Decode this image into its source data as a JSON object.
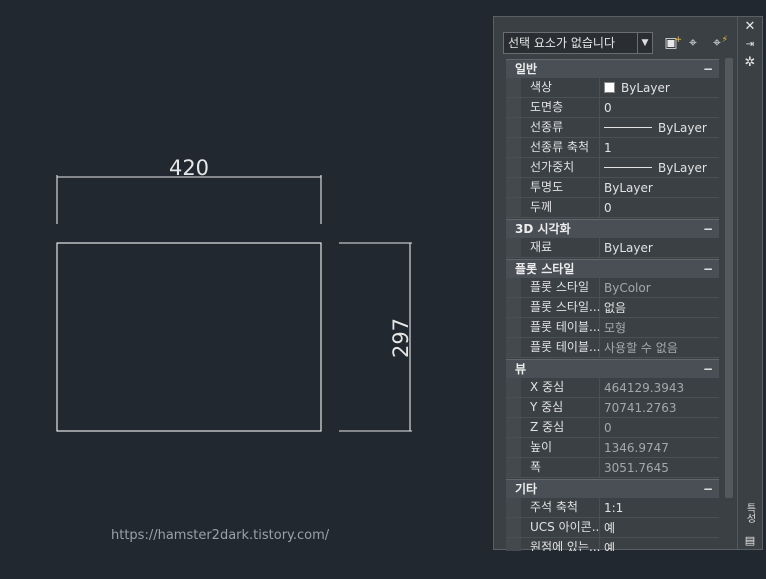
{
  "drawing": {
    "dim_width": "420",
    "dim_height": "297",
    "watermark": "https://hamster2dark.tistory.com/"
  },
  "palette": {
    "selection": "선택 요소가 없습니다",
    "sections": [
      {
        "title": "일반",
        "toggle": "−",
        "rows": [
          {
            "name": "색상",
            "value": "ByLayer",
            "kind": "color"
          },
          {
            "name": "도면층",
            "value": "0"
          },
          {
            "name": "선종류",
            "value": "ByLayer",
            "kind": "line"
          },
          {
            "name": "선종류 축척",
            "value": "1"
          },
          {
            "name": "선가중치",
            "value": "ByLayer",
            "kind": "line"
          },
          {
            "name": "투명도",
            "value": "ByLayer"
          },
          {
            "name": "두께",
            "value": "0"
          }
        ]
      },
      {
        "title": "3D 시각화",
        "toggle": "−",
        "rows": [
          {
            "name": "재료",
            "value": "ByLayer"
          }
        ]
      },
      {
        "title": "플롯 스타일",
        "toggle": "−",
        "rows": [
          {
            "name": "플롯 스타일",
            "value": "ByColor",
            "dim": true
          },
          {
            "name": "플롯 스타일...",
            "value": "없음"
          },
          {
            "name": "플롯 테이블...",
            "value": "모형",
            "dim": true
          },
          {
            "name": "플롯 테이블...",
            "value": "사용할 수 없음",
            "dim": true
          }
        ]
      },
      {
        "title": "뷰",
        "toggle": "−",
        "rows": [
          {
            "name": "X 중심",
            "value": "464129.3943",
            "dim": true
          },
          {
            "name": "Y 중심",
            "value": "70741.2763",
            "dim": true
          },
          {
            "name": "Z 중심",
            "value": "0",
            "dim": true
          },
          {
            "name": "높이",
            "value": "1346.9747",
            "dim": true
          },
          {
            "name": "폭",
            "value": "3051.7645",
            "dim": true
          }
        ]
      },
      {
        "title": "기타",
        "toggle": "−",
        "rows": [
          {
            "name": "주석 축척",
            "value": "1:1"
          },
          {
            "name": "UCS 아이콘...",
            "value": "예"
          },
          {
            "name": "원점에 있는...",
            "value": "예"
          }
        ]
      }
    ],
    "strip_labels": [
      "특성",
      "특성"
    ]
  }
}
